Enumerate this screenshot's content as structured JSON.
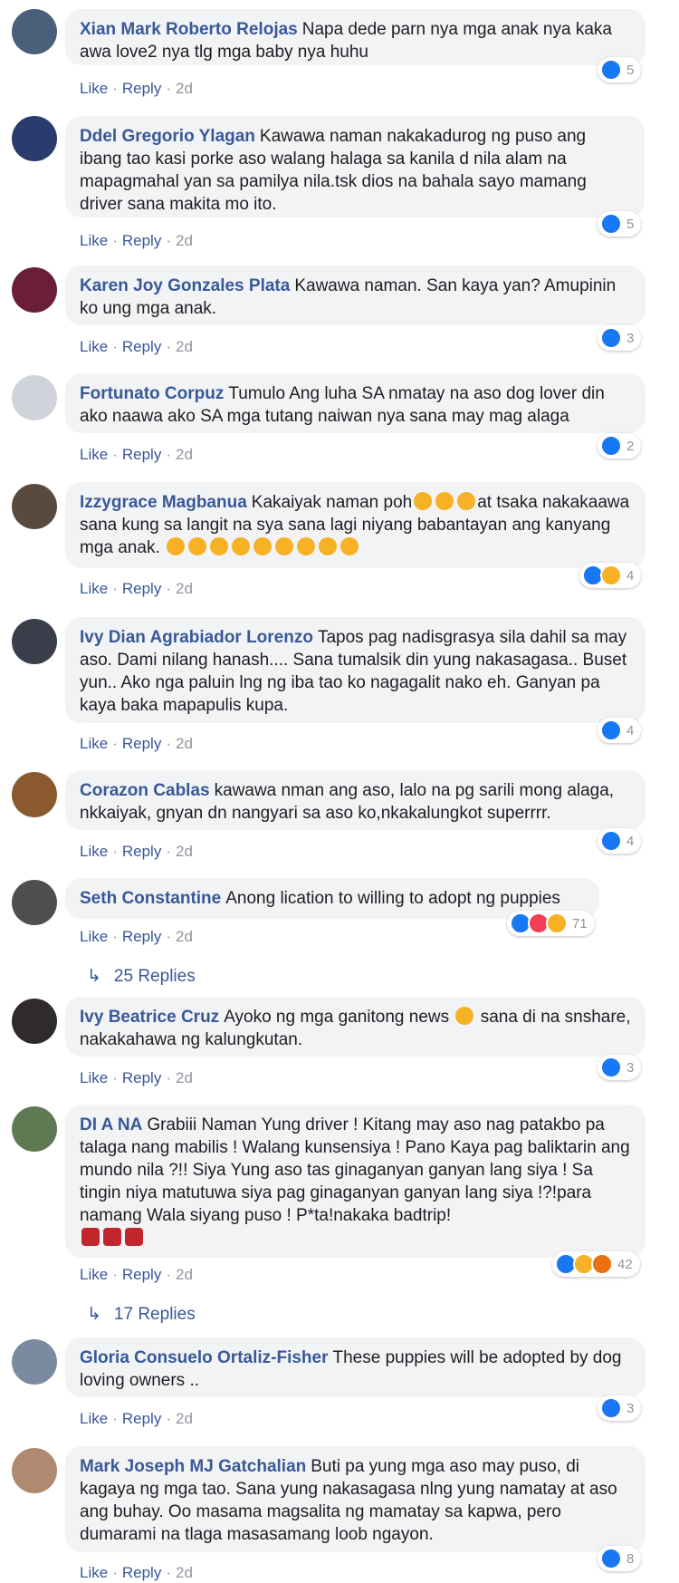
{
  "comments": [
    {
      "name": "Xian Mark Roberto Relojas",
      "text": "Napa dede parn nya mga anak nya kaka awa love2 nya tlg mga baby nya huhu",
      "like": "Like",
      "reply": "Reply",
      "time": "2d",
      "count": "5",
      "avatar_color": "#4a5f7a"
    },
    {
      "name": "Ddel Gregorio Ylagan",
      "text": "Kawawa naman nakakadurog ng puso ang ibang tao kasi porke aso walang halaga sa kanila d nila alam na mapagmahal yan sa pamilya nila.tsk dios na bahala sayo mamang driver sana makita mo ito.",
      "like": "Like",
      "reply": "Reply",
      "time": "2d",
      "count": "5",
      "avatar_color": "#2a3c6e"
    },
    {
      "name": "Karen Joy Gonzales Plata",
      "text": "Kawawa naman. San kaya yan? Amupinin ko ung mga anak.",
      "like": "Like",
      "reply": "Reply",
      "time": "2d",
      "count": "3",
      "avatar_color": "#6b1e3a"
    },
    {
      "name": "Fortunato Corpuz",
      "text": "Tumulo Ang luha SA nmatay na aso dog lover din ako naawa ako SA mga tutang naiwan nya sana may mag alaga",
      "like": "Like",
      "reply": "Reply",
      "time": "2d",
      "count": "2",
      "avatar_color": "#d0d4da"
    },
    {
      "name": "Izzygrace Magbanua",
      "text": "Kakaiyak naman poh",
      "text2": "at tsaka nakakaawa sana kung sa langit na sya sana lagi niyang babantayan ang kanyang mga anak.",
      "like": "Like",
      "reply": "Reply",
      "time": "2d",
      "count": "4",
      "avatar_color": "#5a4a3e"
    },
    {
      "name": "Ivy Dian Agrabiador Lorenzo",
      "text": "Tapos pag nadisgrasya sila dahil sa may aso. Dami nilang hanash.... Sana tumalsik din yung nakasagasa.. Buset yun.. Ako nga paluin lng ng iba tao ko nagagalit nako eh. Ganyan pa kaya baka mapapulis kupa.",
      "like": "Like",
      "reply": "Reply",
      "time": "2d",
      "count": "4",
      "avatar_color": "#3a3e4a"
    },
    {
      "name": "Corazon Cablas",
      "text": "kawawa nman ang aso, lalo na pg sarili mong alaga, nkkaiyak, gnyan dn nangyari sa aso ko,nkakalungkot superrrr.",
      "like": "Like",
      "reply": "Reply",
      "time": "2d",
      "count": "4",
      "avatar_color": "#8a5a2e"
    },
    {
      "name": "Seth Constantine",
      "text": "Anong lication to willing to adopt ng puppies",
      "like": "Like",
      "reply": "Reply",
      "time": "2d",
      "count": "71",
      "replies": "25 Replies",
      "avatar_color": "#4e4e4e"
    },
    {
      "name": "Ivy Beatrice Cruz",
      "text": "Ayoko ng mga ganitong news",
      "text2": "sana di na snshare, nakakahawa ng kalungkutan.",
      "like": "Like",
      "reply": "Reply",
      "time": "2d",
      "count": "3",
      "avatar_color": "#2e2a2e"
    },
    {
      "name": "DI A NA",
      "text": "Grabiii Naman Yung driver ! Kitang may aso nag patakbo pa talaga nang mabilis ! Walang kunsensiya ! Pano Kaya pag baliktarin ang mundo nila ?!! Siya Yung aso tas ginaganyan ganyan lang siya ! Sa tingin niya matutuwa siya pag ginaganyan ganyan lang siya !?!para namang Wala siyang puso ! P*ta!nakaka badtrip!",
      "like": "Like",
      "reply": "Reply",
      "time": "2d",
      "count": "42",
      "replies": "17 Replies",
      "avatar_color": "#5e7a52"
    },
    {
      "name": "Gloria Consuelo Ortaliz-Fisher",
      "text": "These puppies will be adopted by dog loving owners ..",
      "like": "Like",
      "reply": "Reply",
      "time": "2d",
      "count": "3",
      "avatar_color": "#7a8aa0"
    },
    {
      "name": "Mark Joseph MJ Gatchalian",
      "text": "Buti pa yung mga aso may puso, di kagaya ng mga tao. Sana yung nakasagasa nlng yung namatay at aso ang buhay. Oo masama magsalita ng mamatay sa kapwa, pero dumarami na tlaga masasamang loob ngayon.",
      "like": "Like",
      "reply": "Reply",
      "time": "2d",
      "count": "8",
      "avatar_color": "#b08a70"
    }
  ],
  "colors": {
    "link": "#385898",
    "bubble": "#f2f3f5",
    "meta": "#90949c",
    "like_blue": "#1877f2"
  }
}
